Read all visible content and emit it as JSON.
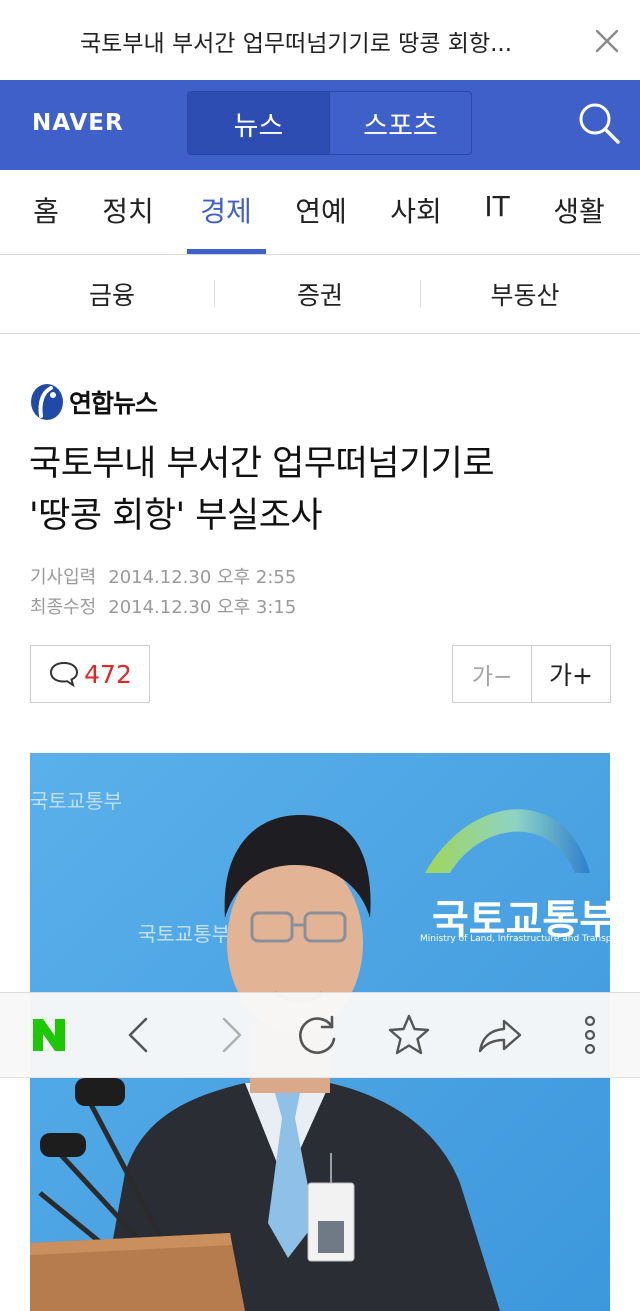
{
  "top_bar": {
    "title": "국토부내 부서간 업무떠넘기기로 땅콩 회항...",
    "close_icon": "close-icon"
  },
  "header": {
    "logo": "NAVER",
    "segments": [
      {
        "label": "뉴스",
        "active": true
      },
      {
        "label": "스포츠",
        "active": false
      }
    ],
    "search_icon": "search-icon",
    "color": "#3f5fc9"
  },
  "categories": [
    {
      "label": "홈"
    },
    {
      "label": "정치"
    },
    {
      "label": "경제",
      "active": true
    },
    {
      "label": "연예"
    },
    {
      "label": "사회"
    },
    {
      "label": "IT"
    },
    {
      "label": "생활"
    }
  ],
  "subcategories": [
    {
      "label": "금융"
    },
    {
      "label": "증권"
    },
    {
      "label": "부동산"
    }
  ],
  "article": {
    "press": "연합뉴스",
    "headline_line1": "국토부내 부서간 업무떠넘기기로",
    "headline_line2": "'땅콩 회항' 부실조사",
    "published_label": "기사입력",
    "published": "2014.12.30 오후 2:55",
    "updated_label": "최종수정",
    "updated": "2014.12.30 오후 3:15",
    "comment_count": "472",
    "font_smaller": "가−",
    "font_larger": "가+",
    "photo_backdrop_text": "국토교통부",
    "photo_backdrop_subtext": "Ministry of Land, Infrastructure and Transport"
  },
  "toolbar": {
    "home": "N",
    "icons": [
      "back-icon",
      "forward-icon",
      "reload-icon",
      "bookmark-star-icon",
      "share-icon",
      "more-icon"
    ]
  },
  "colors": {
    "accent": "#3f5fc9",
    "comment_count": "#e3262a",
    "naver_green": "#1ec800"
  }
}
